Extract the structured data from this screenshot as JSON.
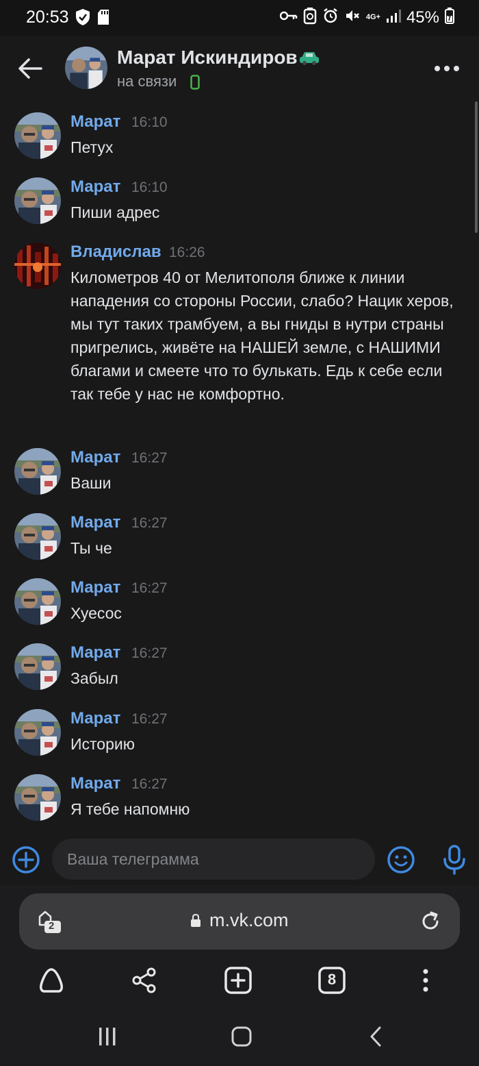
{
  "status_bar": {
    "time": "20:53",
    "network": "4G+",
    "battery": "45%"
  },
  "header": {
    "name": "Марат Искиндиров",
    "status": "на связи",
    "name_emoji_icon": "car-icon",
    "device_icon": "phone-icon"
  },
  "messages": [
    {
      "author": "Марат",
      "time": "16:10",
      "text": "Петух",
      "avatar": "marat"
    },
    {
      "author": "Марат",
      "time": "16:10",
      "text": "Пиши адрес",
      "avatar": "marat"
    },
    {
      "author": "Владислав",
      "time": "16:26",
      "text": "Километров 40 от Мелитополя ближе к линии нападения со стороны России, слабо? Нацик херов, мы тут таких трамбуем, а вы гниды в нутри страны пригрелись, живёте на НАШЕЙ земле, с НАШИМИ благами и смеете что то булькать. Едь к себе если так тебе у нас не комфортно.",
      "avatar": "vladislav"
    },
    {
      "author": "Марат",
      "time": "16:27",
      "text": "Ваши",
      "avatar": "marat"
    },
    {
      "author": "Марат",
      "time": "16:27",
      "text": "Ты че",
      "avatar": "marat"
    },
    {
      "author": "Марат",
      "time": "16:27",
      "text": "Хуесос",
      "avatar": "marat"
    },
    {
      "author": "Марат",
      "time": "16:27",
      "text": "Забыл",
      "avatar": "marat"
    },
    {
      "author": "Марат",
      "time": "16:27",
      "text": "Историю",
      "avatar": "marat"
    },
    {
      "author": "Марат",
      "time": "16:27",
      "text": "Я тебе напомню",
      "avatar": "marat"
    }
  ],
  "composer": {
    "placeholder": "Ваша телеграмма",
    "value": ""
  },
  "browser": {
    "tab_group_count": "2",
    "url": "m.vk.com",
    "open_tabs": "8"
  },
  "colors": {
    "author": "#71aaeb",
    "accent": "#3f8ae0",
    "online": "#4bb34b",
    "background": "#19191a"
  }
}
